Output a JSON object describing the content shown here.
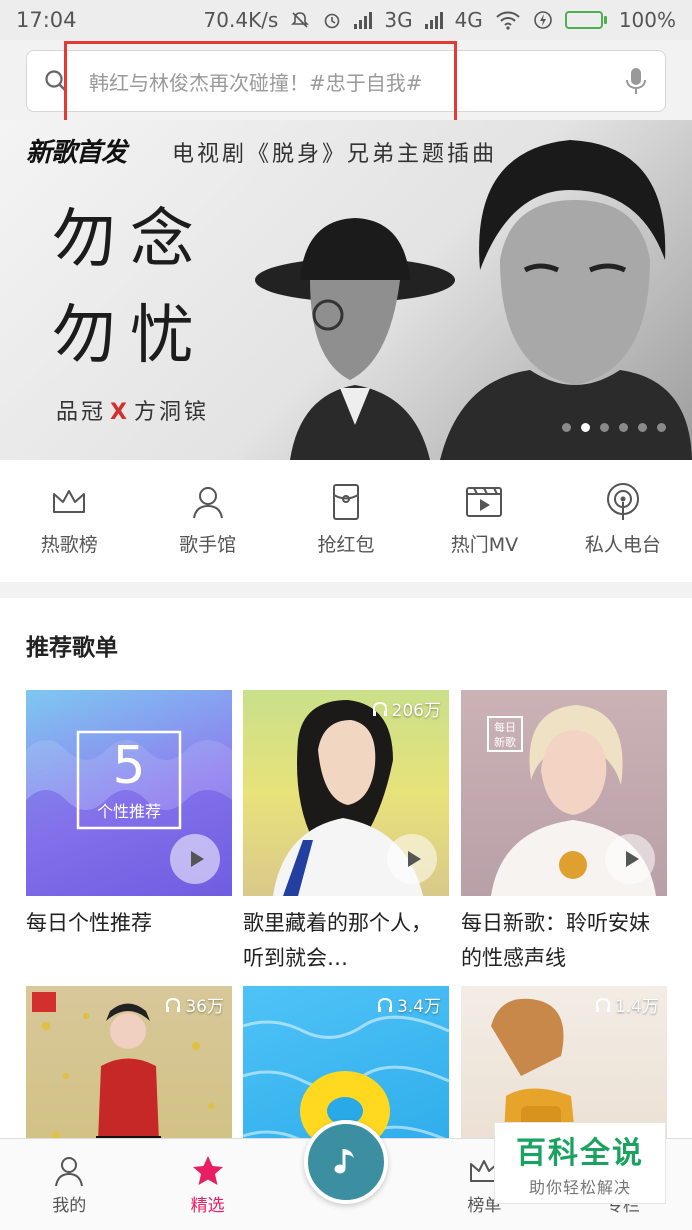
{
  "status_bar": {
    "time": "17:04",
    "net_speed": "70.4K/s",
    "carrier_3g": "3G",
    "carrier_4g": "4G",
    "battery": "100%",
    "battery_level": 1.0
  },
  "search": {
    "placeholder": "韩红与林俊杰再次碰撞！#忠于自我#"
  },
  "banner": {
    "tag": "新歌首发",
    "subtitle": "电视剧《脱身》兄弟主题插曲",
    "poem_line1": "勿念",
    "poem_line2": "勿忧",
    "artist1": "品冠",
    "artist_sep": "X",
    "artist2": "方洞镔",
    "dot_count": 6,
    "active_dot": 1
  },
  "quick_nav": [
    {
      "label": "热歌榜",
      "icon": "crown-icon"
    },
    {
      "label": "歌手馆",
      "icon": "person-icon"
    },
    {
      "label": "抢红包",
      "icon": "red-envelope-icon"
    },
    {
      "label": "热门MV",
      "icon": "video-icon"
    },
    {
      "label": "私人电台",
      "icon": "radio-icon"
    }
  ],
  "recommend": {
    "title": "推荐歌单",
    "cards": [
      {
        "title": "每日个性推荐",
        "plays": "",
        "badge_number": "5",
        "badge_text": "个性推荐"
      },
      {
        "title": "歌里藏着的那个人，听到就会…",
        "plays": "206万"
      },
      {
        "title": "每日新歌：聆听安妹的性感声线",
        "plays": "",
        "badge_text": "每日新歌"
      },
      {
        "title": "",
        "plays": "36万"
      },
      {
        "title": "",
        "plays": "3.4万"
      },
      {
        "title": "",
        "plays": "1.4万"
      }
    ]
  },
  "bottom_nav": [
    {
      "label": "我的",
      "icon": "person-icon",
      "active": false
    },
    {
      "label": "精选",
      "icon": "star-icon",
      "active": true
    },
    {
      "label": "",
      "icon": "music-note-icon",
      "active": false
    },
    {
      "label": "榜单",
      "icon": "crown-icon",
      "active": false
    },
    {
      "label": "专栏",
      "icon": "column-icon",
      "active": false
    }
  ],
  "watermark": {
    "title": "百科全说",
    "subtitle": "助你轻松解决"
  },
  "colors": {
    "accent": "#e91e63",
    "highlight_box": "#e53935",
    "fab": "#3b8fa0",
    "watermark": "#1aa260"
  }
}
